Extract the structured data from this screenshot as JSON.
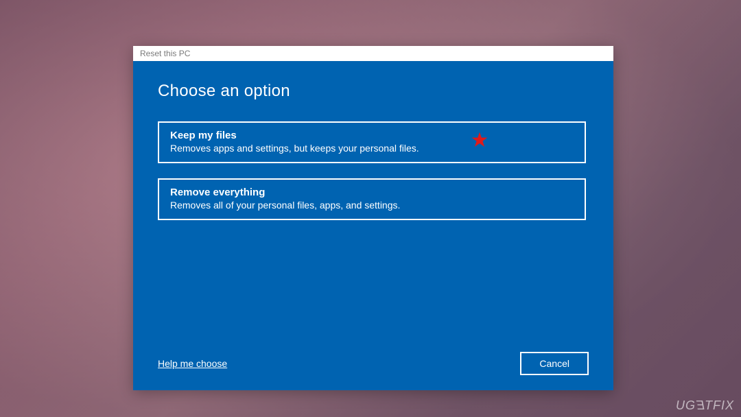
{
  "window": {
    "title": "Reset this PC"
  },
  "heading": "Choose an option",
  "options": [
    {
      "title": "Keep my files",
      "description": "Removes apps and settings, but keeps your personal files.",
      "annotated": true
    },
    {
      "title": "Remove everything",
      "description": "Removes all of your personal files, apps, and settings.",
      "annotated": false
    }
  ],
  "footer": {
    "help_link": "Help me choose",
    "cancel_label": "Cancel"
  },
  "annotation": {
    "star_color": "#E01A1A"
  },
  "watermark": "UGETFIX",
  "colors": {
    "dialog_bg": "#0063B1",
    "text": "#FFFFFF",
    "titlebar_text": "#7a7a7a"
  }
}
